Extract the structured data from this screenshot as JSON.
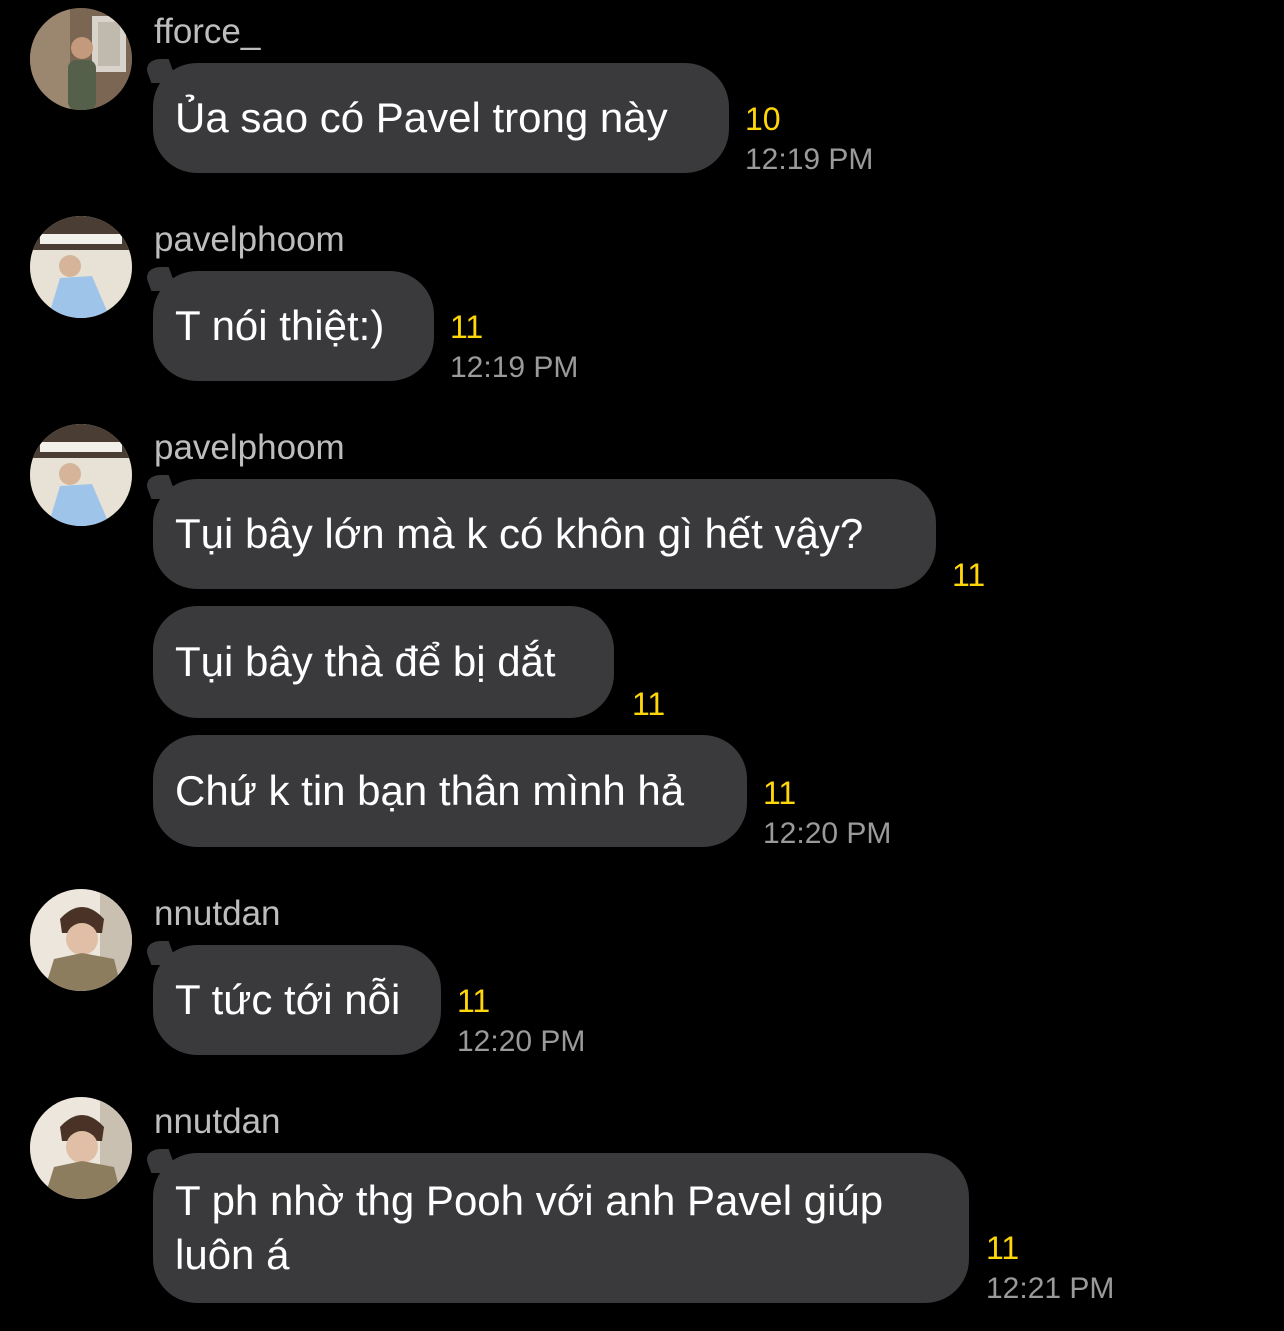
{
  "colors": {
    "background": "#000000",
    "bubble": "#3a3a3c",
    "sender": "#bdbdbd",
    "read_count": "#ffd60a",
    "timestamp": "#9a9a9a"
  },
  "messages": [
    {
      "sender": "fforce_",
      "avatar": "avatar-fforce",
      "bubbles": [
        {
          "text": "Ủa sao có Pavel trong này",
          "count": "10",
          "time": "12:19 PM"
        }
      ]
    },
    {
      "sender": "pavelphoom",
      "avatar": "avatar-pavelphoom",
      "bubbles": [
        {
          "text": "T nói thiệt:)",
          "count": "11",
          "time": "12:19 PM"
        }
      ]
    },
    {
      "sender": "pavelphoom",
      "avatar": "avatar-pavelphoom",
      "bubbles": [
        {
          "text": "Tụi bây lớn mà k có khôn gì hết vậy?",
          "count": "11"
        },
        {
          "text": "Tụi bây thà để bị dắt",
          "count": "11"
        },
        {
          "text": "Chứ k tin bạn thân mình hả",
          "count": "11",
          "time": "12:20 PM"
        }
      ]
    },
    {
      "sender": "nnutdan",
      "avatar": "avatar-nnutdan",
      "bubbles": [
        {
          "text": "T tức tới nỗi",
          "count": "11",
          "time": "12:20 PM"
        }
      ]
    },
    {
      "sender": "nnutdan",
      "avatar": "avatar-nnutdan",
      "bubbles": [
        {
          "lines": [
            "T ph nhờ thg Pooh với anh Pavel giúp",
            "luôn á"
          ],
          "count": "11",
          "time": "12:21 PM"
        }
      ]
    }
  ]
}
